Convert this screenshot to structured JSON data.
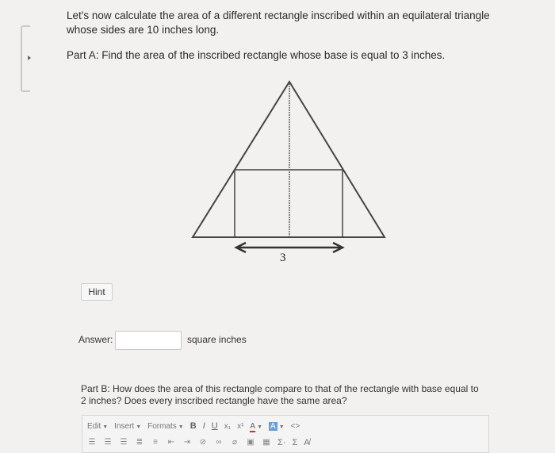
{
  "question": {
    "intro_text": "Let's now calculate the area of a different rectangle inscribed within an equilateral triangle whose sides are 10 inches long.",
    "part_a_text": "Part A: Find the area of the inscribed rectangle whose base is equal to 3 inches.",
    "figure_label": "3"
  },
  "hint": {
    "label": "Hint"
  },
  "answer": {
    "label": "Answer:",
    "value": "",
    "unit": "square inches"
  },
  "part_b": {
    "text": "Part B: How does the area of this rectangle compare to that of the rectangle with base equal to 2 inches? Does every inscribed rectangle have the same area?"
  },
  "editor_toolbar": {
    "row1": {
      "edit": "Edit",
      "insert": "Insert",
      "formats": "Formats",
      "bold": "B",
      "italic": "I",
      "underline": "U",
      "subscript": "x₁",
      "superscript": "x¹",
      "text_color": "A",
      "bg_color": "A",
      "code": "<>"
    },
    "row2": {
      "sigma1": "Σ·",
      "sigma2": "Σ",
      "spellcheck": "A̸"
    }
  },
  "colors": {
    "background": "#f2f1ef",
    "figure_stroke": "#444444"
  }
}
